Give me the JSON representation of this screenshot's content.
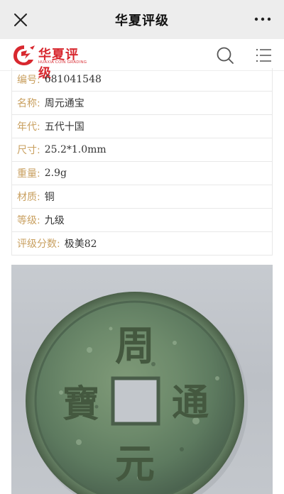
{
  "topbar": {
    "title": "华夏评级",
    "close_icon": "close-icon",
    "more_icon": "more-dots-icon"
  },
  "header": {
    "logo_text": "华夏评级",
    "logo_sub": "HUAXIA COIN GRADING",
    "search_icon": "search-icon",
    "menu_icon": "menu-icon"
  },
  "info": {
    "rows": [
      {
        "label": "编号:",
        "value": "681041548"
      },
      {
        "label": "名称:",
        "value": "周元通宝"
      },
      {
        "label": "年代:",
        "value": "五代十国"
      },
      {
        "label": "尺寸:",
        "value": "25.2*1.0mm"
      },
      {
        "label": "重量:",
        "value": "2.9g"
      },
      {
        "label": "材质:",
        "value": "铜"
      },
      {
        "label": "等级:",
        "value": "九级"
      },
      {
        "label": "评级分数:",
        "value": "极美82"
      }
    ]
  },
  "photo": {
    "coin_chars": [
      "周",
      "元",
      "通",
      "寶"
    ]
  },
  "colors": {
    "brand_red": "#d8282f",
    "label_gold": "#c9a060",
    "topbar_bg": "#ededed"
  }
}
